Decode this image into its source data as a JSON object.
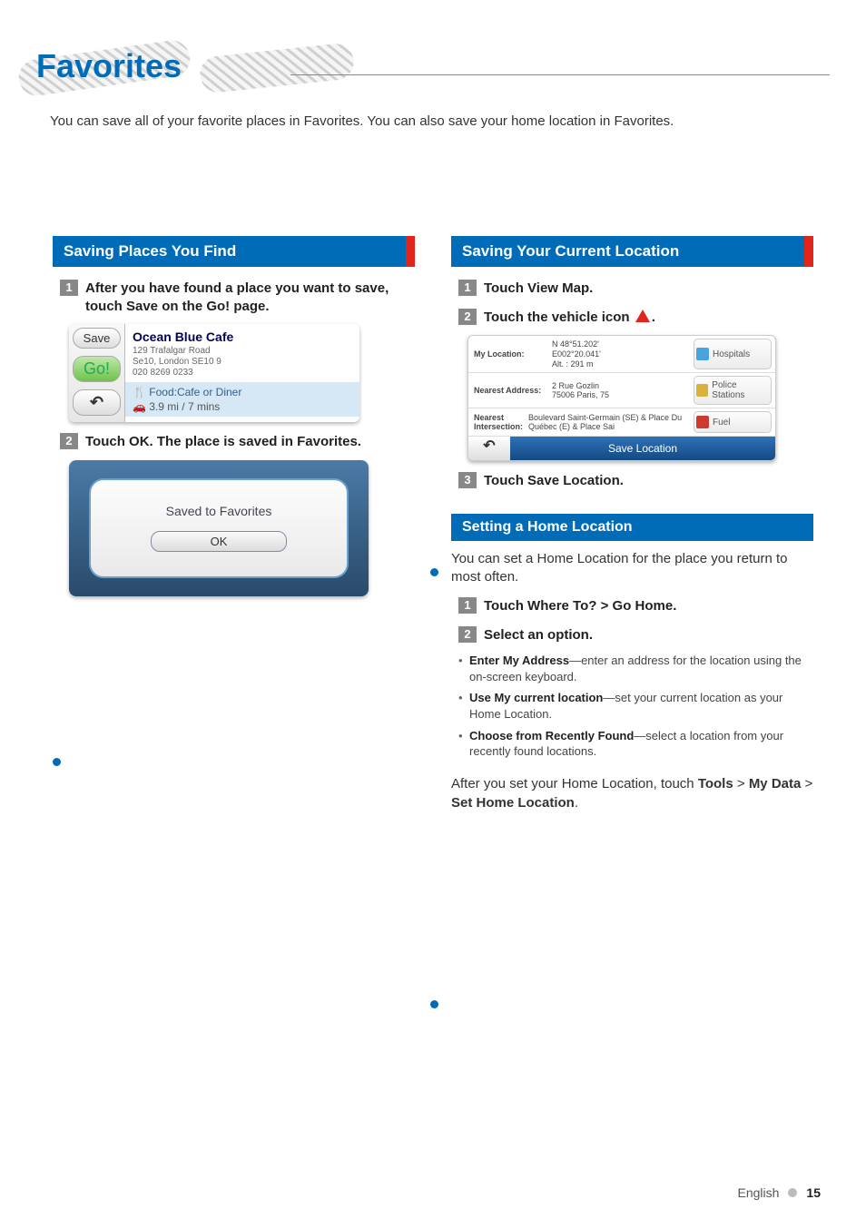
{
  "page_title": "Favorites",
  "intro": "You can save all of your favorite places in Favorites. You can also save your home location in Favorites.",
  "left": {
    "section_title": "Saving Places You Find",
    "step1": "After you have found a place you want to save, touch Save on the Go! page.",
    "step2": "Touch OK. The place is saved in Favorites.",
    "go_page": {
      "save_btn": "Save",
      "go_btn": "Go!",
      "back_glyph": "↶",
      "title": "Ocean Blue Cafe",
      "addr_line1": "129 Trafalgar Road",
      "addr_line2": "Se10, London SE10 9",
      "addr_line3": "020 8269 0233",
      "category_prefix": "Food:",
      "category": "Cafe or Diner",
      "distance": "3.9 mi /  7 mins"
    },
    "fav_dialog": {
      "msg": "Saved to Favorites",
      "ok": "OK"
    }
  },
  "right": {
    "section_title": "Saving Your Current Location",
    "step1": "Touch View Map.",
    "step2_pre": "Touch the vehicle icon ",
    "step2_post": ".",
    "loc_panel": {
      "rows": [
        {
          "label": "My Location:",
          "value": "N 48°51.202'\nE002°20.041'\nAlt. : 291 m",
          "poi": "Hospitals",
          "poi_color": "#4aa3df"
        },
        {
          "label": "Nearest Address:",
          "value": "2 Rue Gozlin\n75006 Paris, 75",
          "poi": "Police Stations",
          "poi_color": "#d9b23c"
        },
        {
          "label": "Nearest Intersection:",
          "value": "Boulevard Saint-Germain (SE) & Place Du Québec (E) & Place Sai",
          "poi": "Fuel",
          "poi_color": "#cc3b2e"
        }
      ],
      "back_glyph": "↶",
      "save_btn": "Save Location"
    },
    "step3": "Touch Save Location.",
    "home": {
      "section_title": "Setting a Home Location",
      "intro": "You can set a Home Location for the place you return to most often.",
      "step1": "Touch Where To? > Go Home.",
      "step2": "Select an option.",
      "options": [
        {
          "name": "Enter My Address",
          "desc": "—enter an address for the location using the on-screen keyboard."
        },
        {
          "name": "Use My current location",
          "desc": "—set your current location as your Home Location."
        },
        {
          "name": "Choose from Recently Found",
          "desc": "—select a location from your recently found locations."
        }
      ],
      "after_pre": "After you set your Home Location, touch ",
      "after_tools": "Tools",
      "after_gt1": " > ",
      "after_mydata": "My Data",
      "after_gt2": " > ",
      "after_sethome": "Set Home Location",
      "after_period": "."
    }
  },
  "footer": {
    "lang": "English",
    "page": "15"
  }
}
